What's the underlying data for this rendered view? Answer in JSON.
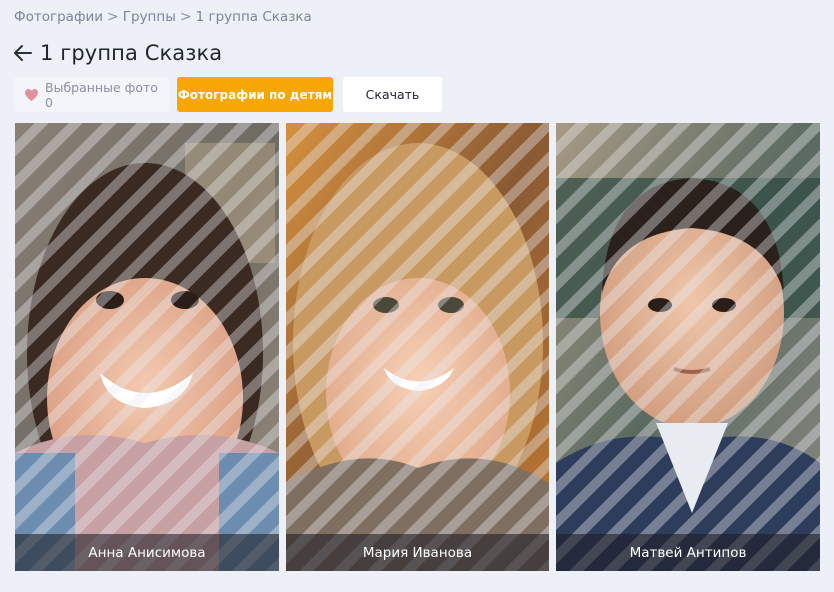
{
  "breadcrumb": {
    "items": [
      "Фотографии",
      "Группы",
      "1 группа Сказка"
    ],
    "separator": ">"
  },
  "header": {
    "title": "1 группа Сказка",
    "back_icon": "arrow-left-icon"
  },
  "toolbar": {
    "favorites_label": "Выбранные фото 0",
    "favorites_icon": "heart-icon",
    "by_children_label": "Фотографии по детям",
    "download_label": "Скачать",
    "accent_color": "#f7a703"
  },
  "children": [
    {
      "name": "Анна Анисимова"
    },
    {
      "name": "Мария Иванова"
    },
    {
      "name": "Матвей Антипов"
    }
  ]
}
